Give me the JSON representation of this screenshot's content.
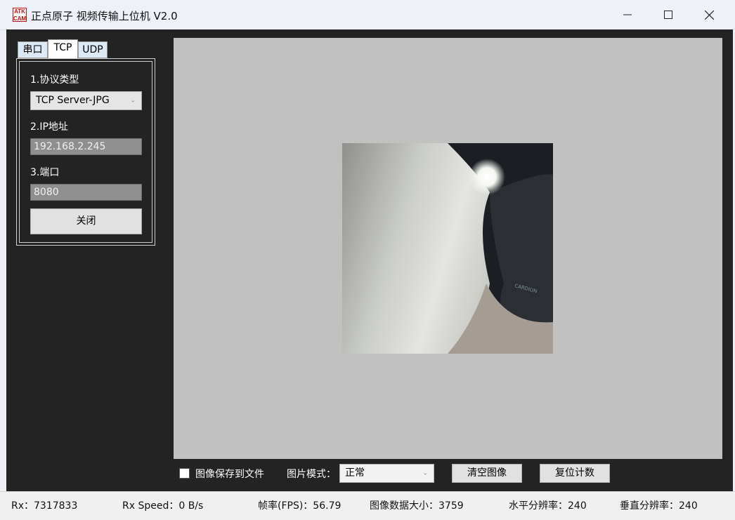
{
  "window": {
    "icon_text": "ATK CAM",
    "title": "正点原子 视频传输上位机 V2.0"
  },
  "tabs": [
    {
      "label": "串口"
    },
    {
      "label": "TCP"
    },
    {
      "label": "UDP"
    }
  ],
  "panel": {
    "protocol_label": "1.协议类型",
    "protocol_value": "TCP Server-JPG",
    "ip_label": "2.IP地址",
    "ip_value": "192.168.2.245",
    "port_label": "3.端口",
    "port_value": "8080",
    "close_button": "关闭"
  },
  "controls": {
    "save_to_file_label": "图像保存到文件",
    "save_to_file_checked": false,
    "image_mode_label": "图片模式：",
    "image_mode_value": "正常",
    "clear_image_button": "清空图像",
    "reset_count_button": "复位计数"
  },
  "status": {
    "rx": "Rx：7317833",
    "rx_speed": "Rx Speed：0 B/s",
    "fps": "帧率(FPS)：56.79",
    "image_size": "图像数据大小：3759",
    "h_res": "水平分辨率：240",
    "v_res": "垂直分辨率：240"
  },
  "colors": {
    "client_bg": "#232323",
    "preview_bg": "#c1c1c1",
    "status_bg": "#f0f0f0"
  }
}
